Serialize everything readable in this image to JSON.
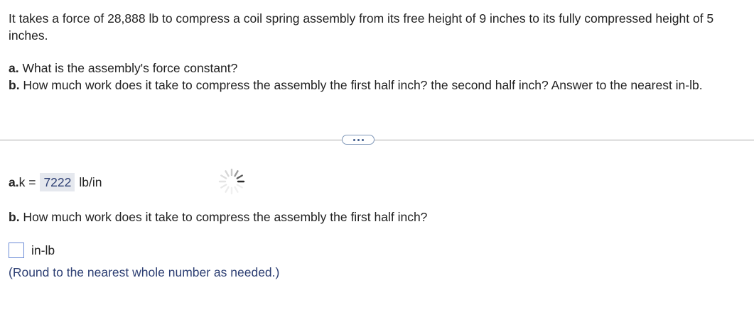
{
  "question": {
    "intro": "It takes a force of 28,888 lb to compress a coil spring assembly from its free height of 9 inches to its fully compressed height of 5 inches.",
    "part_a_label": "a.",
    "part_a_text": " What is the assembly's force constant?",
    "part_b_label": "b.",
    "part_b_text": " How much work does it take to compress the assembly the first half inch? the second half inch? Answer to the nearest in-lb."
  },
  "answer_a": {
    "label": "a.",
    "prefix": " k =",
    "value": "7222",
    "unit": "lb/in"
  },
  "answer_b": {
    "label": "b.",
    "text": " How much work does it take to compress the assembly the first half inch?",
    "input_value": "",
    "unit": "in-lb",
    "hint": "(Round to the nearest whole number as needed.)"
  },
  "icons": {
    "more": "more-options-icon",
    "loading": "loading-spinner-icon"
  },
  "colors": {
    "answer_text": "#2d3f73",
    "answer_bg": "#e5e8ee",
    "input_border": "#6b8bd6"
  }
}
